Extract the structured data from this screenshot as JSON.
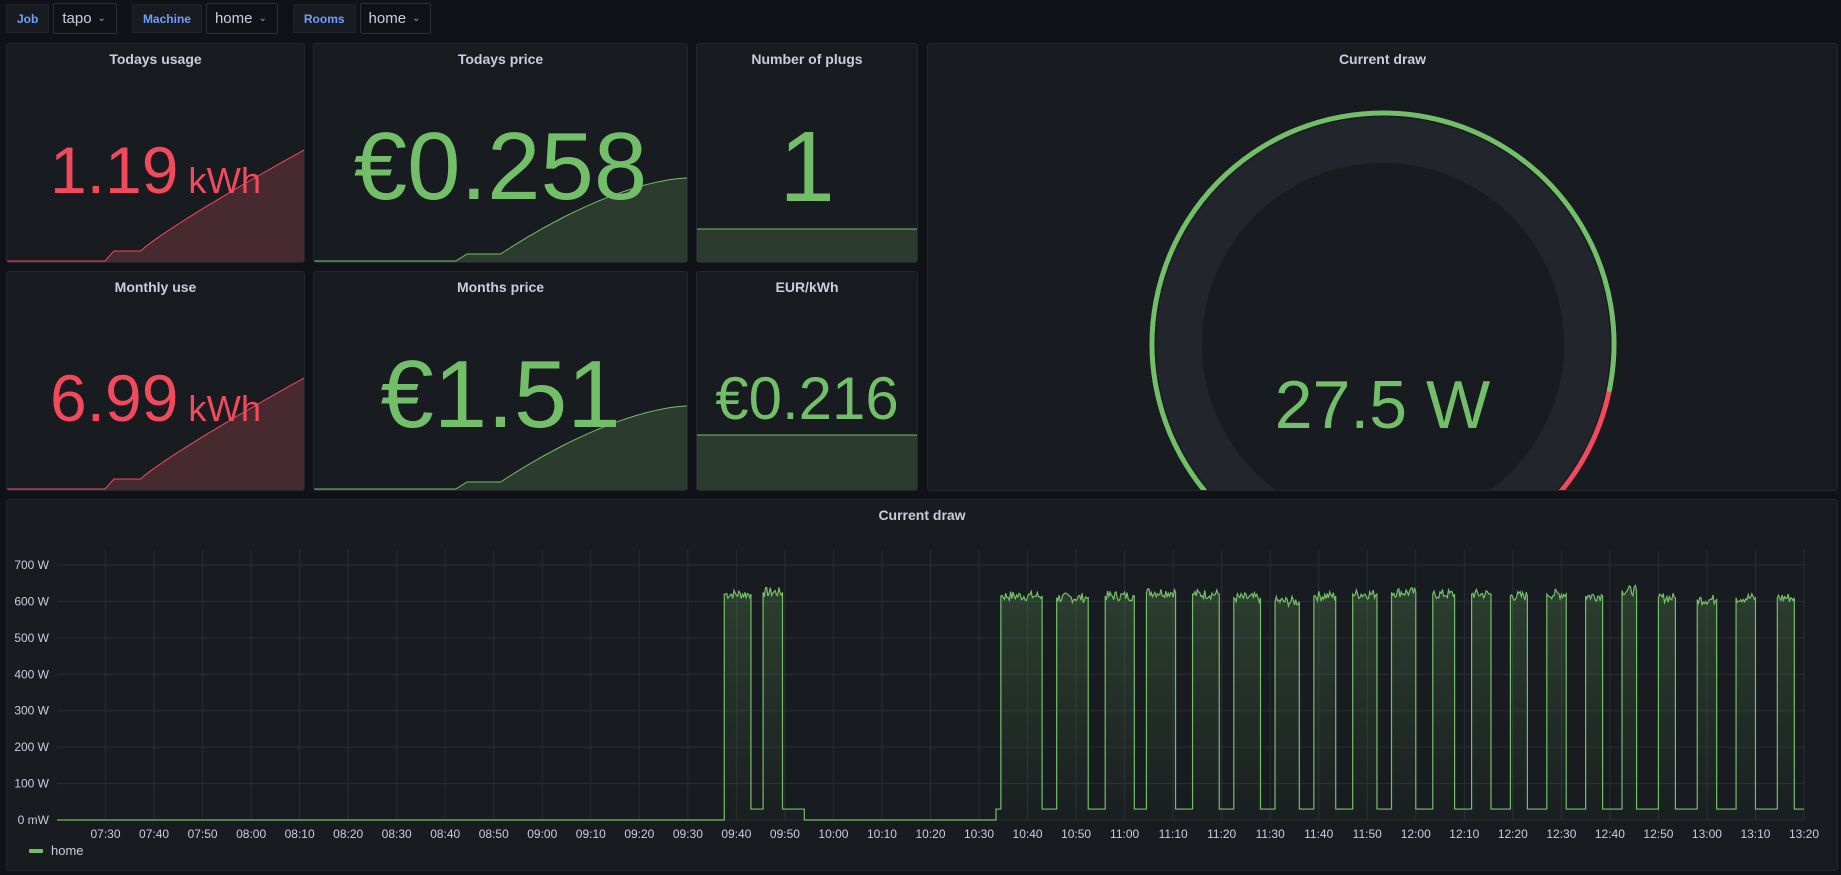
{
  "variables": [
    {
      "label": "Job",
      "value": "tapo"
    },
    {
      "label": "Machine",
      "value": "home"
    },
    {
      "label": "Rooms",
      "value": "home"
    }
  ],
  "colors": {
    "green": "#73bf69",
    "red": "#f2495c",
    "green_fill": "#2b3c2e",
    "red_fill": "#472a2f",
    "gauge_track": "#22252b"
  },
  "stats": {
    "todays_usage": {
      "title": "Todays usage",
      "value": "1.19",
      "unit": "kWh",
      "color": "red"
    },
    "todays_price": {
      "title": "Todays price",
      "value": "€0.258",
      "color": "green"
    },
    "number_of_plugs": {
      "title": "Number of plugs",
      "value": "1",
      "color": "green"
    },
    "monthly_use": {
      "title": "Monthly use",
      "value": "6.99",
      "unit": "kWh",
      "color": "red"
    },
    "months_price": {
      "title": "Months price",
      "value": "€1.51",
      "color": "green"
    },
    "eur_kwh": {
      "title": "EUR/kWh",
      "value": "€0.216",
      "color": "green"
    }
  },
  "gauge": {
    "title": "Current draw",
    "value_text": "27.5 W",
    "value": 27.5,
    "min": 0,
    "max": 700,
    "threshold_red_at": 560
  },
  "timeseries": {
    "title": "Current draw",
    "legend": "home"
  },
  "chart_data": {
    "type": "line",
    "title": "Current draw",
    "xlabel": "",
    "ylabel": "",
    "legend": [
      "home"
    ],
    "legend_position": "bottom-left",
    "grid": true,
    "x_range": [
      "07:20",
      "13:20"
    ],
    "ylim": [
      0,
      700
    ],
    "y_ticks": [
      "0 mW",
      "100 W",
      "200 W",
      "300 W",
      "400 W",
      "500 W",
      "600 W",
      "700 W"
    ],
    "x_ticks": [
      "07:30",
      "07:40",
      "07:50",
      "08:00",
      "08:10",
      "08:20",
      "08:30",
      "08:40",
      "08:50",
      "09:00",
      "09:10",
      "09:20",
      "09:30",
      "09:40",
      "09:50",
      "10:00",
      "10:10",
      "10:20",
      "10:30",
      "10:40",
      "10:50",
      "11:00",
      "11:10",
      "11:20",
      "11:30",
      "11:40",
      "11:50",
      "12:00",
      "12:10",
      "12:20",
      "12:30",
      "12:40",
      "12:50",
      "13:00",
      "13:10",
      "13:20"
    ],
    "series": [
      {
        "name": "home",
        "baseline_on_idle_w": 30,
        "segments_note": "minutes since 07:20 [start,end,watts]",
        "segments": [
          [
            0,
            137.5,
            0
          ],
          [
            137.5,
            143,
            620
          ],
          [
            143,
            145.5,
            30
          ],
          [
            145.5,
            149.5,
            625
          ],
          [
            149.5,
            154,
            30
          ],
          [
            154,
            193.5,
            0
          ],
          [
            193.5,
            194.5,
            30
          ],
          [
            194.5,
            203,
            615
          ],
          [
            203,
            206,
            30
          ],
          [
            206,
            212.5,
            610
          ],
          [
            212.5,
            216,
            30
          ],
          [
            216,
            222,
            615
          ],
          [
            222,
            224.5,
            30
          ],
          [
            224.5,
            230.5,
            625
          ],
          [
            230.5,
            234,
            30
          ],
          [
            234,
            239.5,
            620
          ],
          [
            239.5,
            242.5,
            30
          ],
          [
            242.5,
            248,
            610
          ],
          [
            248,
            251,
            30
          ],
          [
            251,
            256,
            600
          ],
          [
            256,
            259,
            30
          ],
          [
            259,
            263.5,
            615
          ],
          [
            263.5,
            267,
            30
          ],
          [
            267,
            272,
            620
          ],
          [
            272,
            275,
            30
          ],
          [
            275,
            280,
            625
          ],
          [
            280,
            283.5,
            30
          ],
          [
            283.5,
            288,
            620
          ],
          [
            288,
            291.5,
            30
          ],
          [
            291.5,
            295.5,
            620
          ],
          [
            295.5,
            299.5,
            30
          ],
          [
            299.5,
            303,
            615
          ],
          [
            303,
            307,
            30
          ],
          [
            307,
            311,
            620
          ],
          [
            311,
            315,
            30
          ],
          [
            315,
            318.5,
            615
          ],
          [
            318.5,
            322.5,
            30
          ],
          [
            322.5,
            325.5,
            630
          ],
          [
            325.5,
            330,
            30
          ],
          [
            330,
            333.5,
            610
          ],
          [
            333.5,
            338,
            30
          ],
          [
            338,
            342,
            605
          ],
          [
            342,
            346,
            30
          ],
          [
            346,
            350,
            610
          ],
          [
            350,
            354.5,
            30
          ],
          [
            354.5,
            358,
            610
          ],
          [
            358,
            360,
            30
          ]
        ]
      }
    ]
  }
}
